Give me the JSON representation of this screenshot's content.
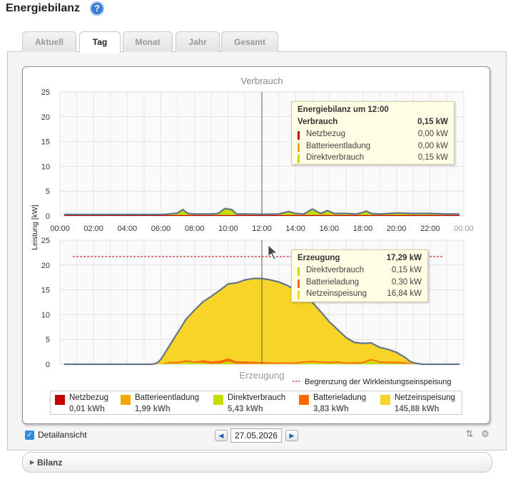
{
  "page_title": "Energiebilanz",
  "tabs": [
    {
      "label": "Aktuell",
      "active": false
    },
    {
      "label": "Tag",
      "active": true
    },
    {
      "label": "Monat",
      "active": false
    },
    {
      "label": "Jahr",
      "active": false
    },
    {
      "label": "Gesamt",
      "active": false
    }
  ],
  "y_axis_label": "Leistung [kW]",
  "tooltip_top": {
    "title": "Energiebilanz um 12:00",
    "header_label": "Verbrauch",
    "header_value": "0,15 kW",
    "rows": [
      {
        "label": "Netzbezug",
        "value": "0,00 kW",
        "color": "#c40000"
      },
      {
        "label": "Batterieentladung",
        "value": "0,00 kW",
        "color": "#f5a800"
      },
      {
        "label": "Direktverbrauch",
        "value": "0,15 kW",
        "color": "#c5dc00"
      }
    ]
  },
  "tooltip_bottom": {
    "header_label": "Erzeugung",
    "header_value": "17,29 kW",
    "rows": [
      {
        "label": "Direktverbrauch",
        "value": "0,15 kW",
        "color": "#c5dc00"
      },
      {
        "label": "Batterieladung",
        "value": "0,30 kW",
        "color": "#ff6a00"
      },
      {
        "label": "Netzeinspeisung",
        "value": "16,84 kW",
        "color": "#f7d428"
      }
    ]
  },
  "legend": [
    {
      "label": "Netzbezug",
      "value": "0,01 kWh",
      "color": "#c40000"
    },
    {
      "label": "Batterieentladung",
      "value": "1,99 kWh",
      "color": "#f5a800"
    },
    {
      "label": "Direktverbrauch",
      "value": "5,43 kWh",
      "color": "#c5dc00"
    },
    {
      "label": "Batterieladung",
      "value": "3,83 kWh",
      "color": "#ff6a00"
    },
    {
      "label": "Netzeinspeisung",
      "value": "145,88 kWh",
      "color": "#f7d428"
    }
  ],
  "limit_legend": "Begrenzung der Wirkleistungseinspeisung",
  "detail_label": "Detailansicht",
  "detail_checked": true,
  "date": "27.05.2026",
  "bilanz_label": "Bilanz",
  "chart_data": [
    {
      "type": "area",
      "title": "Verbrauch",
      "ylim": [
        0,
        25
      ],
      "yticks": [
        0,
        5,
        10,
        15,
        20,
        25
      ],
      "x_ticks": [
        "00:00",
        "02:00",
        "04:00",
        "06:00",
        "08:00",
        "10:00",
        "12:00",
        "14:00",
        "16:00",
        "18:00",
        "20:00",
        "22:00",
        "00:00"
      ],
      "x_hours": [
        0.25,
        1,
        2,
        3,
        4,
        5,
        6,
        6.5,
        7,
        7.3,
        7.6,
        8,
        9,
        9.4,
        9.8,
        10.2,
        10.5,
        11,
        12,
        13,
        13.6,
        14,
        14.5,
        15,
        15.5,
        15.9,
        16.3,
        17,
        17.6,
        18,
        18.2,
        18.5,
        19,
        19.6,
        20,
        21,
        22,
        23,
        23.75
      ],
      "series": [
        {
          "name": "Netzbezug",
          "values": [
            0.2,
            0.2,
            0.2,
            0.2,
            0.2,
            0.2,
            0.2,
            0.2,
            0.2,
            0.2,
            0.2,
            0.2,
            0.2,
            0.2,
            0.2,
            0.2,
            0.2,
            0.2,
            0.2,
            0.2,
            0.2,
            0.2,
            0.2,
            0.2,
            0.2,
            0.2,
            0.2,
            0.2,
            0.2,
            0.2,
            0.2,
            0.2,
            0.2,
            0.2,
            0.2,
            0.2,
            0.2,
            0.2,
            0.2
          ]
        },
        {
          "name": "Direktverbrauch",
          "values": [
            0.1,
            0.1,
            0.1,
            0.1,
            0.1,
            0.1,
            0.1,
            0.2,
            0.4,
            1.1,
            0.3,
            0.2,
            0.2,
            0.3,
            1.3,
            1.1,
            0.2,
            0.2,
            0.15,
            0.2,
            0.7,
            0.3,
            0.2,
            1.2,
            0.3,
            0.9,
            0.3,
            0.3,
            0.2,
            0.5,
            0.8,
            0.3,
            0.2,
            0.3,
            0.4,
            0.3,
            0.3,
            0.2,
            0.2
          ]
        }
      ],
      "tooltip_time": "12:00"
    },
    {
      "type": "area",
      "title": "Erzeugung",
      "ylim": [
        0,
        25
      ],
      "yticks": [
        0,
        5,
        10,
        15,
        20,
        25
      ],
      "limit_line": 21.7,
      "x_hours": [
        0.25,
        5.5,
        5.8,
        6,
        6.5,
        7,
        7.5,
        8,
        8.5,
        9,
        9.5,
        10,
        10.5,
        11,
        11.5,
        12,
        12.5,
        13,
        13.5,
        14,
        14.5,
        15,
        15.5,
        16,
        16.5,
        17,
        17.5,
        18,
        18.5,
        19,
        19.5,
        20,
        20.5,
        20.8,
        21,
        21.5,
        22,
        23.75
      ],
      "series": [
        {
          "name": "Direktverbrauch",
          "values": [
            0,
            0,
            0,
            0.1,
            0.2,
            0.2,
            0.5,
            0.3,
            0.3,
            0.1,
            0.1,
            0.6,
            0.1,
            0.1,
            0.1,
            0.15,
            0.1,
            0.1,
            0.1,
            0.1,
            0.3,
            0.4,
            0.3,
            0.2,
            0.3,
            0.1,
            0.1,
            0.2,
            0.8,
            0.3,
            0.2,
            0.2,
            0.1,
            0.1,
            0.1,
            0,
            0,
            0
          ]
        },
        {
          "name": "Batterieladung",
          "values": [
            0,
            0,
            0,
            0,
            0.3,
            0.3,
            0.3,
            0.3,
            0.5,
            0.5,
            0.6,
            0.6,
            0.5,
            0.5,
            0.4,
            0.3,
            0.3,
            0.3,
            0.3,
            0.3,
            0.3,
            0.3,
            0.3,
            0.3,
            0.3,
            0.3,
            0.3,
            0.3,
            0.3,
            0.3,
            0.3,
            0.3,
            0.3,
            0.2,
            0.1,
            0,
            0,
            0
          ]
        },
        {
          "name": "Netzeinspeisung",
          "values": [
            0,
            0,
            0.3,
            0.9,
            3.2,
            5.9,
            8.3,
            10.3,
            11.8,
            13.1,
            14.2,
            15.0,
            15.8,
            16.4,
            16.8,
            16.84,
            16.6,
            16.2,
            15.5,
            14.6,
            13.3,
            11.8,
            10.0,
            8.1,
            6.4,
            5.0,
            4.0,
            3.7,
            3.2,
            2.8,
            2.5,
            1.9,
            1.0,
            0.3,
            0.1,
            0,
            0,
            0
          ]
        }
      ],
      "tooltip_time": "12:00"
    }
  ]
}
